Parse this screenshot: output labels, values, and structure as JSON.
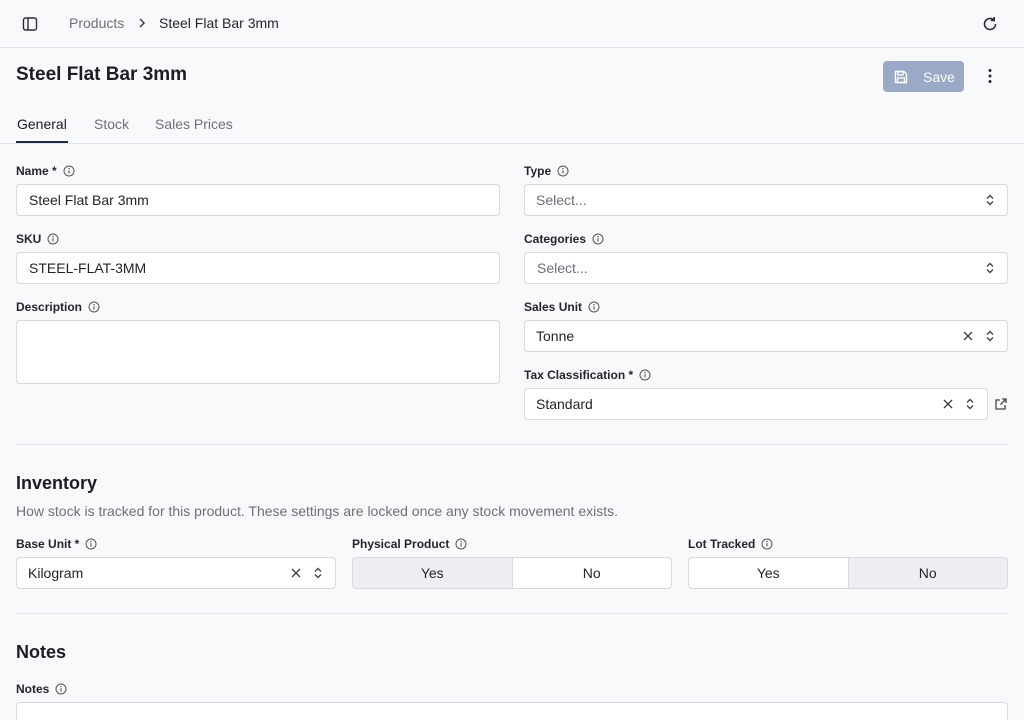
{
  "breadcrumb": {
    "parent": "Products",
    "current": "Steel Flat Bar 3mm"
  },
  "page": {
    "title": "Steel Flat Bar 3mm",
    "save_label": "Save"
  },
  "tabs": [
    {
      "label": "General"
    },
    {
      "label": "Stock"
    },
    {
      "label": "Sales Prices"
    }
  ],
  "general": {
    "name": {
      "label": "Name *",
      "value": "Steel Flat Bar 3mm"
    },
    "sku": {
      "label": "SKU",
      "value": "STEEL-FLAT-3MM"
    },
    "description": {
      "label": "Description",
      "value": ""
    },
    "type": {
      "label": "Type",
      "placeholder": "Select..."
    },
    "categories": {
      "label": "Categories",
      "placeholder": "Select..."
    },
    "sales_unit": {
      "label": "Sales Unit",
      "value": "Tonne"
    },
    "tax_classification": {
      "label": "Tax Classification *",
      "value": "Standard"
    }
  },
  "inventory": {
    "title": "Inventory",
    "description": "How stock is tracked for this product. These settings are locked once any stock movement exists.",
    "base_unit": {
      "label": "Base Unit *",
      "value": "Kilogram"
    },
    "physical_product": {
      "label": "Physical Product",
      "yes": "Yes",
      "no": "No",
      "selected": "Yes"
    },
    "lot_tracked": {
      "label": "Lot Tracked",
      "yes": "Yes",
      "no": "No",
      "selected": "No"
    }
  },
  "notes": {
    "title": "Notes",
    "label": "Notes",
    "value": ""
  },
  "colors": {
    "accent": "#1f2a44",
    "save_button": "#9aa9c5",
    "selected_toggle": "#eceef1"
  }
}
